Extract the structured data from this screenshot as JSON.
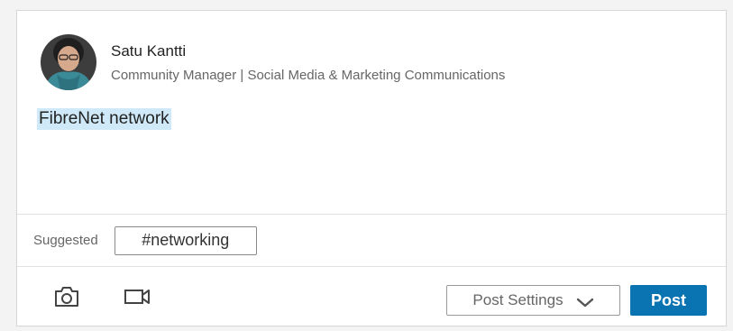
{
  "author": {
    "name": "Satu Kantti",
    "headline": "Community Manager | Social Media & Marketing Communications",
    "avatar_icon": "user-avatar"
  },
  "post": {
    "text": "FibreNet network"
  },
  "suggestions": {
    "label": "Suggested",
    "hashtags": [
      "#networking"
    ]
  },
  "toolbar": {
    "photo_icon": "camera-icon",
    "video_icon": "video-icon",
    "settings_label": "Post Settings",
    "post_label": "Post"
  },
  "colors": {
    "accent": "#0a73b1",
    "highlight": "#cfe9f9"
  }
}
